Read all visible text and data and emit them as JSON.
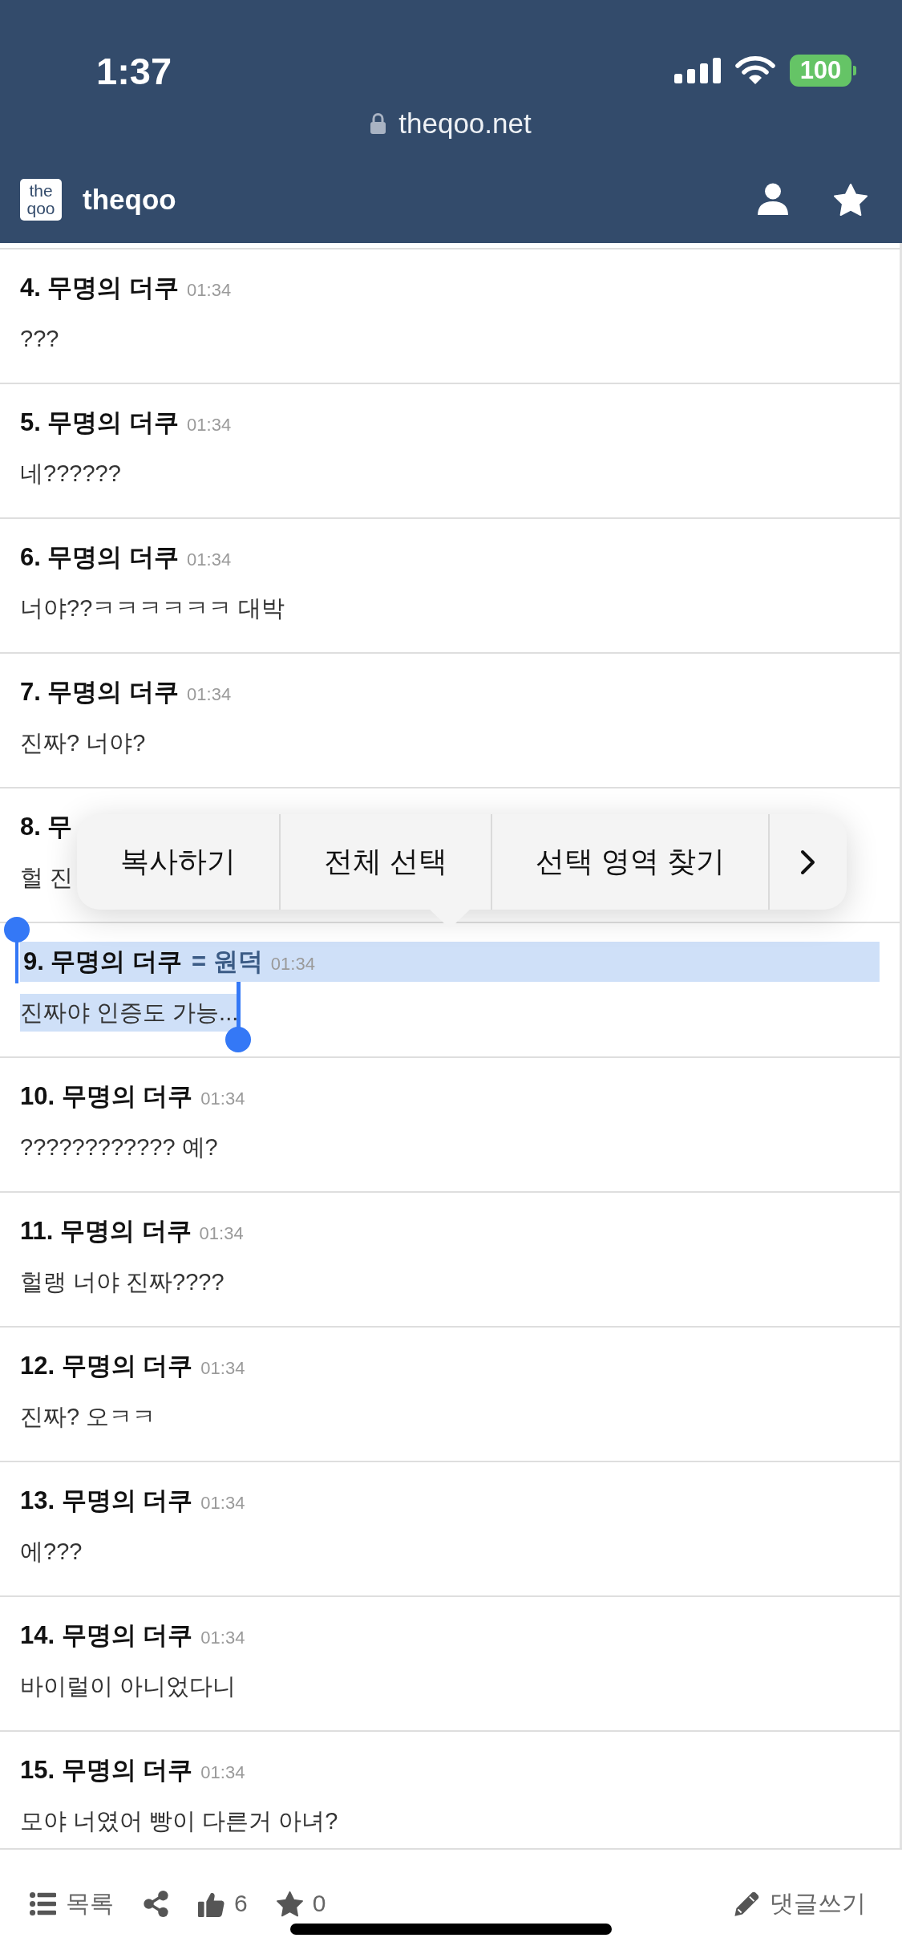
{
  "status_bar": {
    "time": "1:37",
    "battery": "100"
  },
  "address_bar": {
    "url": "theqoo.net"
  },
  "nav_bar": {
    "logo_lines": [
      "the",
      "qoo"
    ],
    "title": "theqoo"
  },
  "comments": [
    {
      "author": "4. 무명의 더쿠",
      "time": "01:34",
      "body": "???",
      "selected": false
    },
    {
      "author": "5. 무명의 더쿠",
      "time": "01:34",
      "body": "네??????",
      "selected": false
    },
    {
      "author": "6. 무명의 더쿠",
      "time": "01:34",
      "body": "너야??ㅋㅋㅋㅋㅋㅋ 대박",
      "selected": false
    },
    {
      "author": "7. 무명의 더쿠",
      "time": "01:34",
      "body": "진짜? 너야?",
      "selected": false
    },
    {
      "author": "8. 무",
      "body": "헐 진",
      "selected": false
    },
    {
      "author": "9. 무명의 더쿠",
      "tag": "= 원덕",
      "time": "01:34",
      "body": "진짜야 인증도 가능...",
      "selected": true
    },
    {
      "author": "10. 무명의 더쿠",
      "time": "01:34",
      "body": "???????????? 예?",
      "selected": false
    },
    {
      "author": "11. 무명의 더쿠",
      "time": "01:34",
      "body": "헐랭 너야 진짜????",
      "selected": false
    },
    {
      "author": "12. 무명의 더쿠",
      "time": "01:34",
      "body": "진짜? 오ㅋㅋ",
      "selected": false
    },
    {
      "author": "13. 무명의 더쿠",
      "time": "01:34",
      "body": "에???",
      "selected": false
    },
    {
      "author": "14. 무명의 더쿠",
      "time": "01:34",
      "body": "바이럴이 아니었다니",
      "selected": false
    },
    {
      "author": "15. 무명의 더쿠",
      "time": "01:34",
      "body": "모야 너였어 빵이 다른거 아녀?",
      "selected": false
    }
  ],
  "context_menu": {
    "items": [
      {
        "kind": "text",
        "label": "복사하기"
      },
      {
        "kind": "text",
        "label": "전체 선택"
      },
      {
        "kind": "text",
        "label": "선택 영역 찾기"
      },
      {
        "kind": "more"
      }
    ]
  },
  "toolbar": {
    "items": [
      {
        "kind": "list",
        "label": "목록"
      },
      {
        "kind": "share"
      },
      {
        "kind": "like",
        "label": "6"
      },
      {
        "kind": "star",
        "label": "0"
      },
      {
        "kind": "write",
        "label": "댓글쓰기"
      }
    ]
  }
}
